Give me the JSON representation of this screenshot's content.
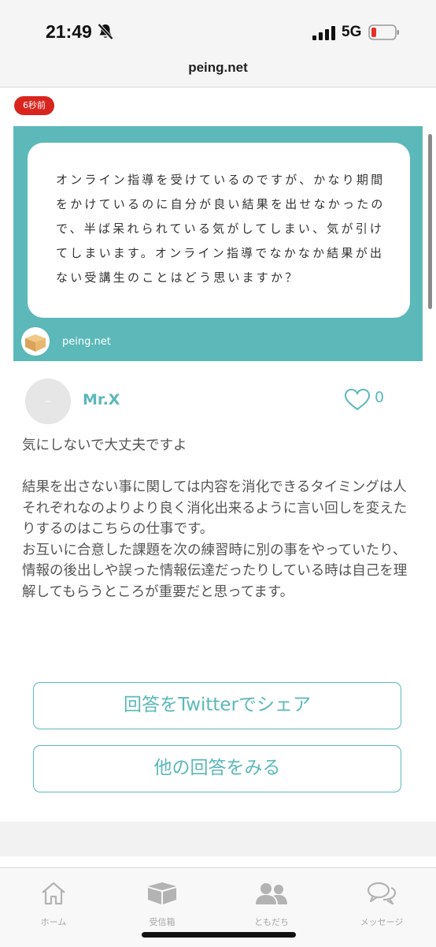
{
  "status_bar": {
    "time": "21:49",
    "network": "5G",
    "url": "peing.net"
  },
  "question": {
    "time_ago": "6秒前",
    "text": "オンライン指導を受けているのですが、かなり期間をかけているのに自分が良い結果を出せなかったので、半ば呆れられている気がしてしまい、気が引けてしまいます。オンライン指導でなかなか結果が出ない受講生のことはどう思いますか？",
    "domain": "peing.net"
  },
  "answer": {
    "avatar_text": "–",
    "username": "Mr.X",
    "like_count": "0",
    "text": "気にしないで大丈夫ですよ\n\n結果を出さない事に関しては内容を消化できるタイミングは人それぞれなのよりより良く消化出来るように言い回しを変えたりするのはこちらの仕事です。\nお互いに合意した課題を次の練習時に別の事をやっていたり、情報の後出しや誤った情報伝達だったりしている時は自己を理解してもらうところが重要だと思ってます。"
  },
  "buttons": {
    "share": "回答をTwitterでシェア",
    "more": "他の回答をみる"
  },
  "tabbar": {
    "home": "ホーム",
    "inbox": "受信箱",
    "friends": "ともだち",
    "messages": "メッセージ"
  },
  "colors": {
    "accent": "#5cb8b9",
    "badge": "#d9251d",
    "icon": "#b3b3b3"
  }
}
